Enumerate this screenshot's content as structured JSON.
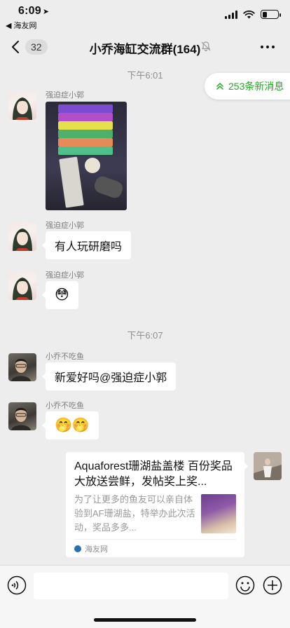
{
  "status_bar": {
    "time": "6:09",
    "location_arrow": "➤",
    "back_app": "◀ 海友网",
    "battery_level": 0.3
  },
  "nav": {
    "unread_count": "32",
    "title": "小乔海缸交流群(164)",
    "icons": [
      "back-chevron-icon",
      "mute-bell-icon",
      "more-dots-icon"
    ]
  },
  "new_messages": {
    "label": "253条新消息",
    "icon": "double-chevron-up-icon",
    "color": "#1aad19"
  },
  "messages": [
    {
      "type": "time",
      "text": "下午6:01"
    },
    {
      "type": "image",
      "sender": "强迫症小郭",
      "image_desc_icon": "photo"
    },
    {
      "type": "text",
      "sender": "强迫症小郭",
      "text": "有人玩研磨吗"
    },
    {
      "type": "emoji",
      "sender": "强迫症小郭",
      "text": "😳"
    },
    {
      "type": "time",
      "text": "下午6:07"
    },
    {
      "type": "text",
      "sender": "小乔不吃鱼",
      "text": "新爱好吗@强迫症小郭"
    },
    {
      "type": "emoji",
      "sender": "小乔不吃鱼",
      "text": "🤭🤭"
    },
    {
      "type": "link",
      "title": "Aquaforest珊湖盐盖楼 百份奖品大放送尝鲜，发帖奖上奖...",
      "description": "为了让更多的鱼友可以亲自体验到AF珊湖盐，特举办此次活动，奖品多多...",
      "source": "海友网"
    }
  ],
  "input_bar": {
    "icons": [
      "voice-icon",
      "emoji-icon",
      "plus-icon"
    ]
  }
}
